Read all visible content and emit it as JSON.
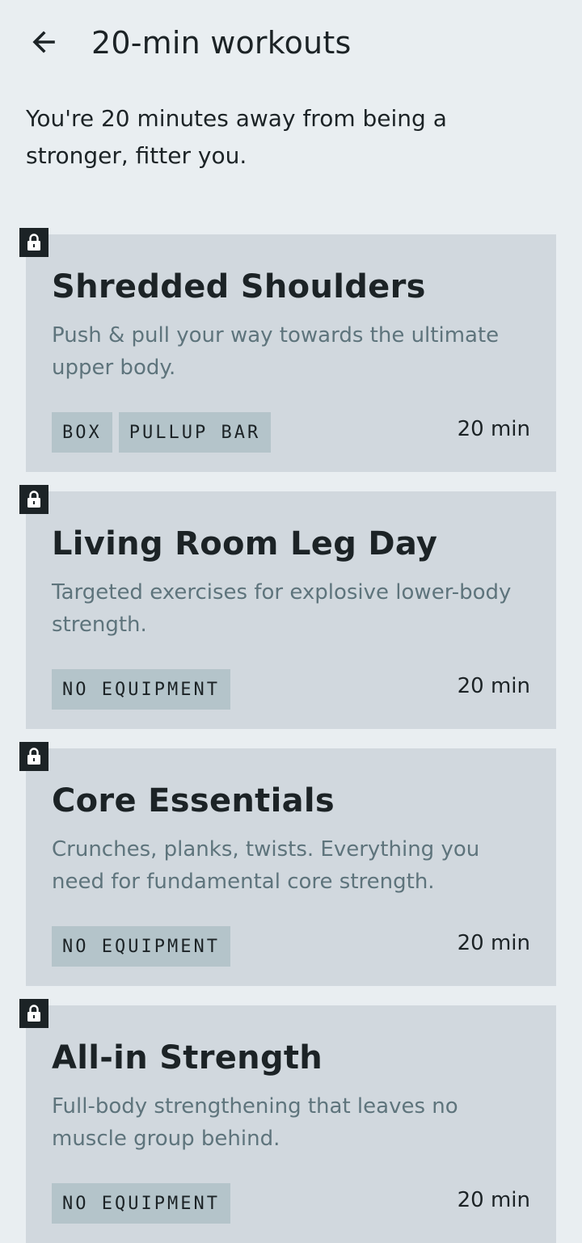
{
  "header": {
    "title": "20-min workouts",
    "back_icon": "arrow-left-icon"
  },
  "intro": "You're 20 minutes away from being a stronger, fitter you.",
  "colors": {
    "background": "#e9eef1",
    "card": "#d1d8de",
    "tag": "#b4c4ca",
    "lock_badge": "#1c2326",
    "description_text": "#5e747c"
  },
  "workouts": [
    {
      "title": "Shredded Shoulders",
      "description": "Push & pull your way towards the ultimate upper body.",
      "tags": [
        "BOX",
        "PULLUP BAR"
      ],
      "duration": "20 min",
      "locked": true
    },
    {
      "title": "Living Room Leg Day",
      "description": "Targeted exercises for explosive lower-body strength.",
      "tags": [
        "NO EQUIPMENT"
      ],
      "duration": "20 min",
      "locked": true
    },
    {
      "title": "Core Essentials",
      "description": "Crunches, planks, twists. Everything you need for fundamental core strength.",
      "tags": [
        "NO EQUIPMENT"
      ],
      "duration": "20 min",
      "locked": true
    },
    {
      "title": "All-in Strength",
      "description": "Full-body strengthening that leaves no muscle group behind.",
      "tags": [
        "NO EQUIPMENT"
      ],
      "duration": "20 min",
      "locked": true
    }
  ]
}
